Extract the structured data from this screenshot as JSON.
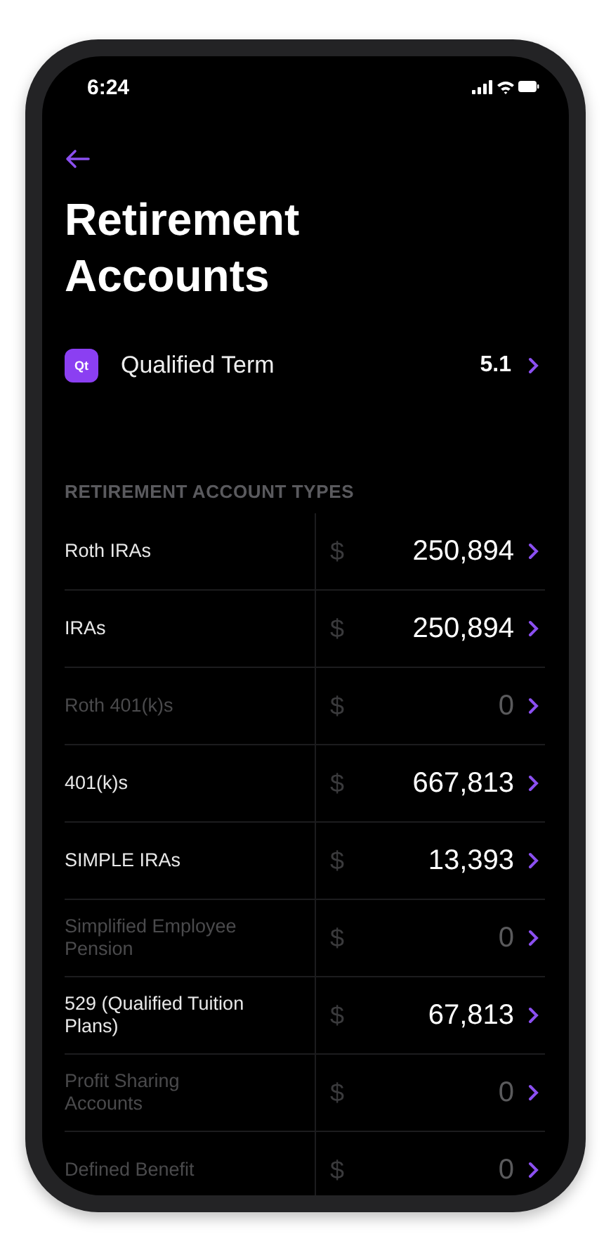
{
  "status_bar": {
    "time": "6:24"
  },
  "title": "Retirement Accounts",
  "summary": {
    "badge": "Qt",
    "label": "Qualified Term",
    "value": "5.1"
  },
  "section": {
    "heading": "RETIREMENT ACCOUNT TYPES",
    "rows": [
      {
        "label": "Roth IRAs",
        "currency": "$",
        "amount": "250,894",
        "muted": false
      },
      {
        "label": "IRAs",
        "currency": "$",
        "amount": "250,894",
        "muted": false
      },
      {
        "label": "Roth 401(k)s",
        "currency": "$",
        "amount": "0",
        "muted": true
      },
      {
        "label": "401(k)s",
        "currency": "$",
        "amount": "667,813",
        "muted": false
      },
      {
        "label": "SIMPLE IRAs",
        "currency": "$",
        "amount": "13,393",
        "muted": false
      },
      {
        "label": "Simplified Employee Pension",
        "currency": "$",
        "amount": "0",
        "muted": true
      },
      {
        "label": "529 (Qualified Tuition Plans)",
        "currency": "$",
        "amount": "67,813",
        "muted": false
      },
      {
        "label": "Profit Sharing Accounts",
        "currency": "$",
        "amount": "0",
        "muted": true
      },
      {
        "label": "Defined Benefit",
        "currency": "$",
        "amount": "0",
        "muted": true
      }
    ]
  }
}
